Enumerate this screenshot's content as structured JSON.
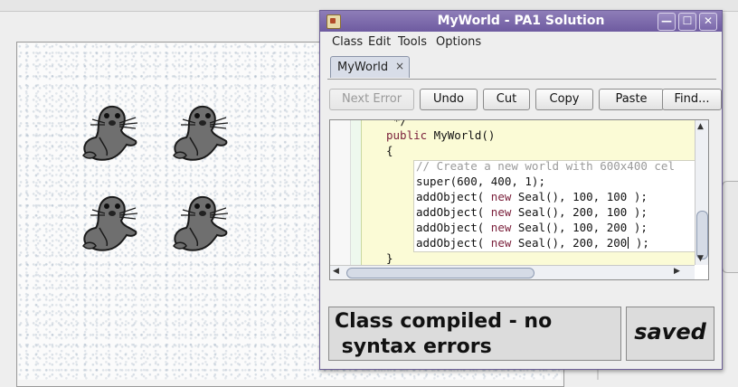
{
  "window": {
    "title": "MyWorld - PA1 Solution",
    "min_glyph": "—",
    "max_glyph": "☐",
    "close_glyph": "✕"
  },
  "menu": {
    "items": [
      "Class",
      "Edit",
      "Tools",
      "Options"
    ]
  },
  "tabs": [
    {
      "label": "MyWorld",
      "close": "×"
    }
  ],
  "toolbar": {
    "next_error": "Next Error",
    "undo": "Undo",
    "cut": "Cut",
    "copy": "Copy",
    "paste": "Paste",
    "find": "Find..."
  },
  "code": {
    "frag_top": "*/",
    "sig_kw": "public",
    "sig_name": " MyWorld()",
    "open_brace": "{",
    "comment": "// Create a new world with 600x400 cel",
    "super_call": "super(600, 400, 1);",
    "lines": [
      {
        "pre": "addObject( ",
        "kw": "new",
        "post": " Seal(), 100, 100 );"
      },
      {
        "pre": "addObject( ",
        "kw": "new",
        "post": " Seal(), 200, 100 );"
      },
      {
        "pre": "addObject( ",
        "kw": "new",
        "post": " Seal(), 100, 200 );"
      },
      {
        "pre": "addObject( ",
        "kw": "new",
        "post": " Seal(), 200, 200",
        "tail": " );"
      }
    ],
    "close_method": "}",
    "close_class": "}"
  },
  "status": {
    "message": "Class compiled - no\n syntax errors",
    "saved": "saved"
  },
  "world": {
    "actor_icon": "seal-icon",
    "actor_count": 4
  },
  "colors": {
    "titlebar": "#7a68aa",
    "keyword": "#7a1f3a",
    "method_scope": "#fbfbd6",
    "class_scope": "#eef8ee"
  }
}
